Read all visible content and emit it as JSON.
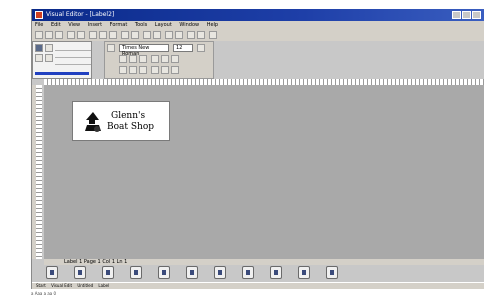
{
  "window": {
    "title": "Visual Editor - [Label2]"
  },
  "menu": [
    "File",
    "Edit",
    "View",
    "Insert",
    "Format",
    "Tools",
    "Layout",
    "Window",
    "Help"
  ],
  "fontpanel": {
    "font": "Times New Roman",
    "size": "12"
  },
  "label": {
    "line1": "Glenn's",
    "line2": "Boat Shop"
  },
  "statusbar": {
    "text": "Label 1 Page 1 Col 1 Ln 1"
  },
  "taskbar": {
    "start": "Start",
    "items": [
      "Visual Edit",
      "Untitled",
      "Label"
    ]
  },
  "footer": {
    "text": "a Aaa a aa 0"
  },
  "colors": {
    "titlebar": "#1e3fa8",
    "canvas": "#a9a9a9",
    "panel": "#d4d0c8"
  },
  "icons": [
    "app-icon",
    "minimize-icon",
    "maximize-icon",
    "close-icon",
    "logo-icon"
  ]
}
